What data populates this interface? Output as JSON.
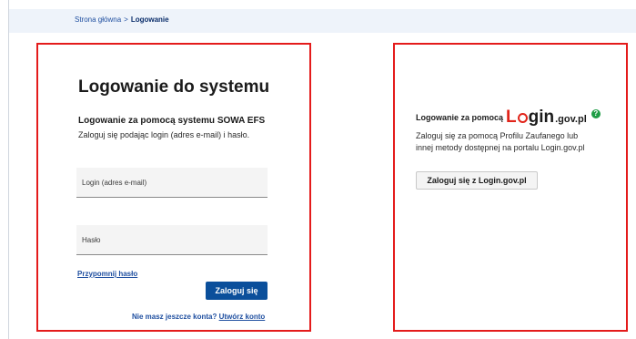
{
  "breadcrumb": {
    "home": "Strona główna",
    "separator": ">",
    "current": "Logowanie"
  },
  "left": {
    "title": "Logowanie do systemu",
    "subtitle": "Logowanie za pomocą systemu SOWA EFS",
    "description": "Zaloguj się podając login (adres e-mail) i hasło.",
    "login_placeholder": "Login (adres e-mail)",
    "password_placeholder": "Hasło",
    "remind_link": "Przypomnij hasło",
    "login_button": "Zaloguj się",
    "register_prompt": "Nie masz jeszcze konta?",
    "register_link": "Utwórz konto"
  },
  "right": {
    "heading_prefix": "Logowanie za pomocą",
    "logo": {
      "letter_l": "L",
      "rest": "gin",
      "domain": ".gov.pl"
    },
    "help_icon": "question-circle-icon",
    "help_glyph": "?",
    "description_line1": "Zaloguj się za pomocą Profilu Zaufanego lub",
    "description_line2": "innej metody dostępnej na portalu Login.gov.pl",
    "button": "Zaloguj się z Login.gov.pl"
  },
  "colors": {
    "accent_blue": "#0b4f9b",
    "highlight_red": "#e41b1b",
    "help_green": "#1f9d46"
  }
}
